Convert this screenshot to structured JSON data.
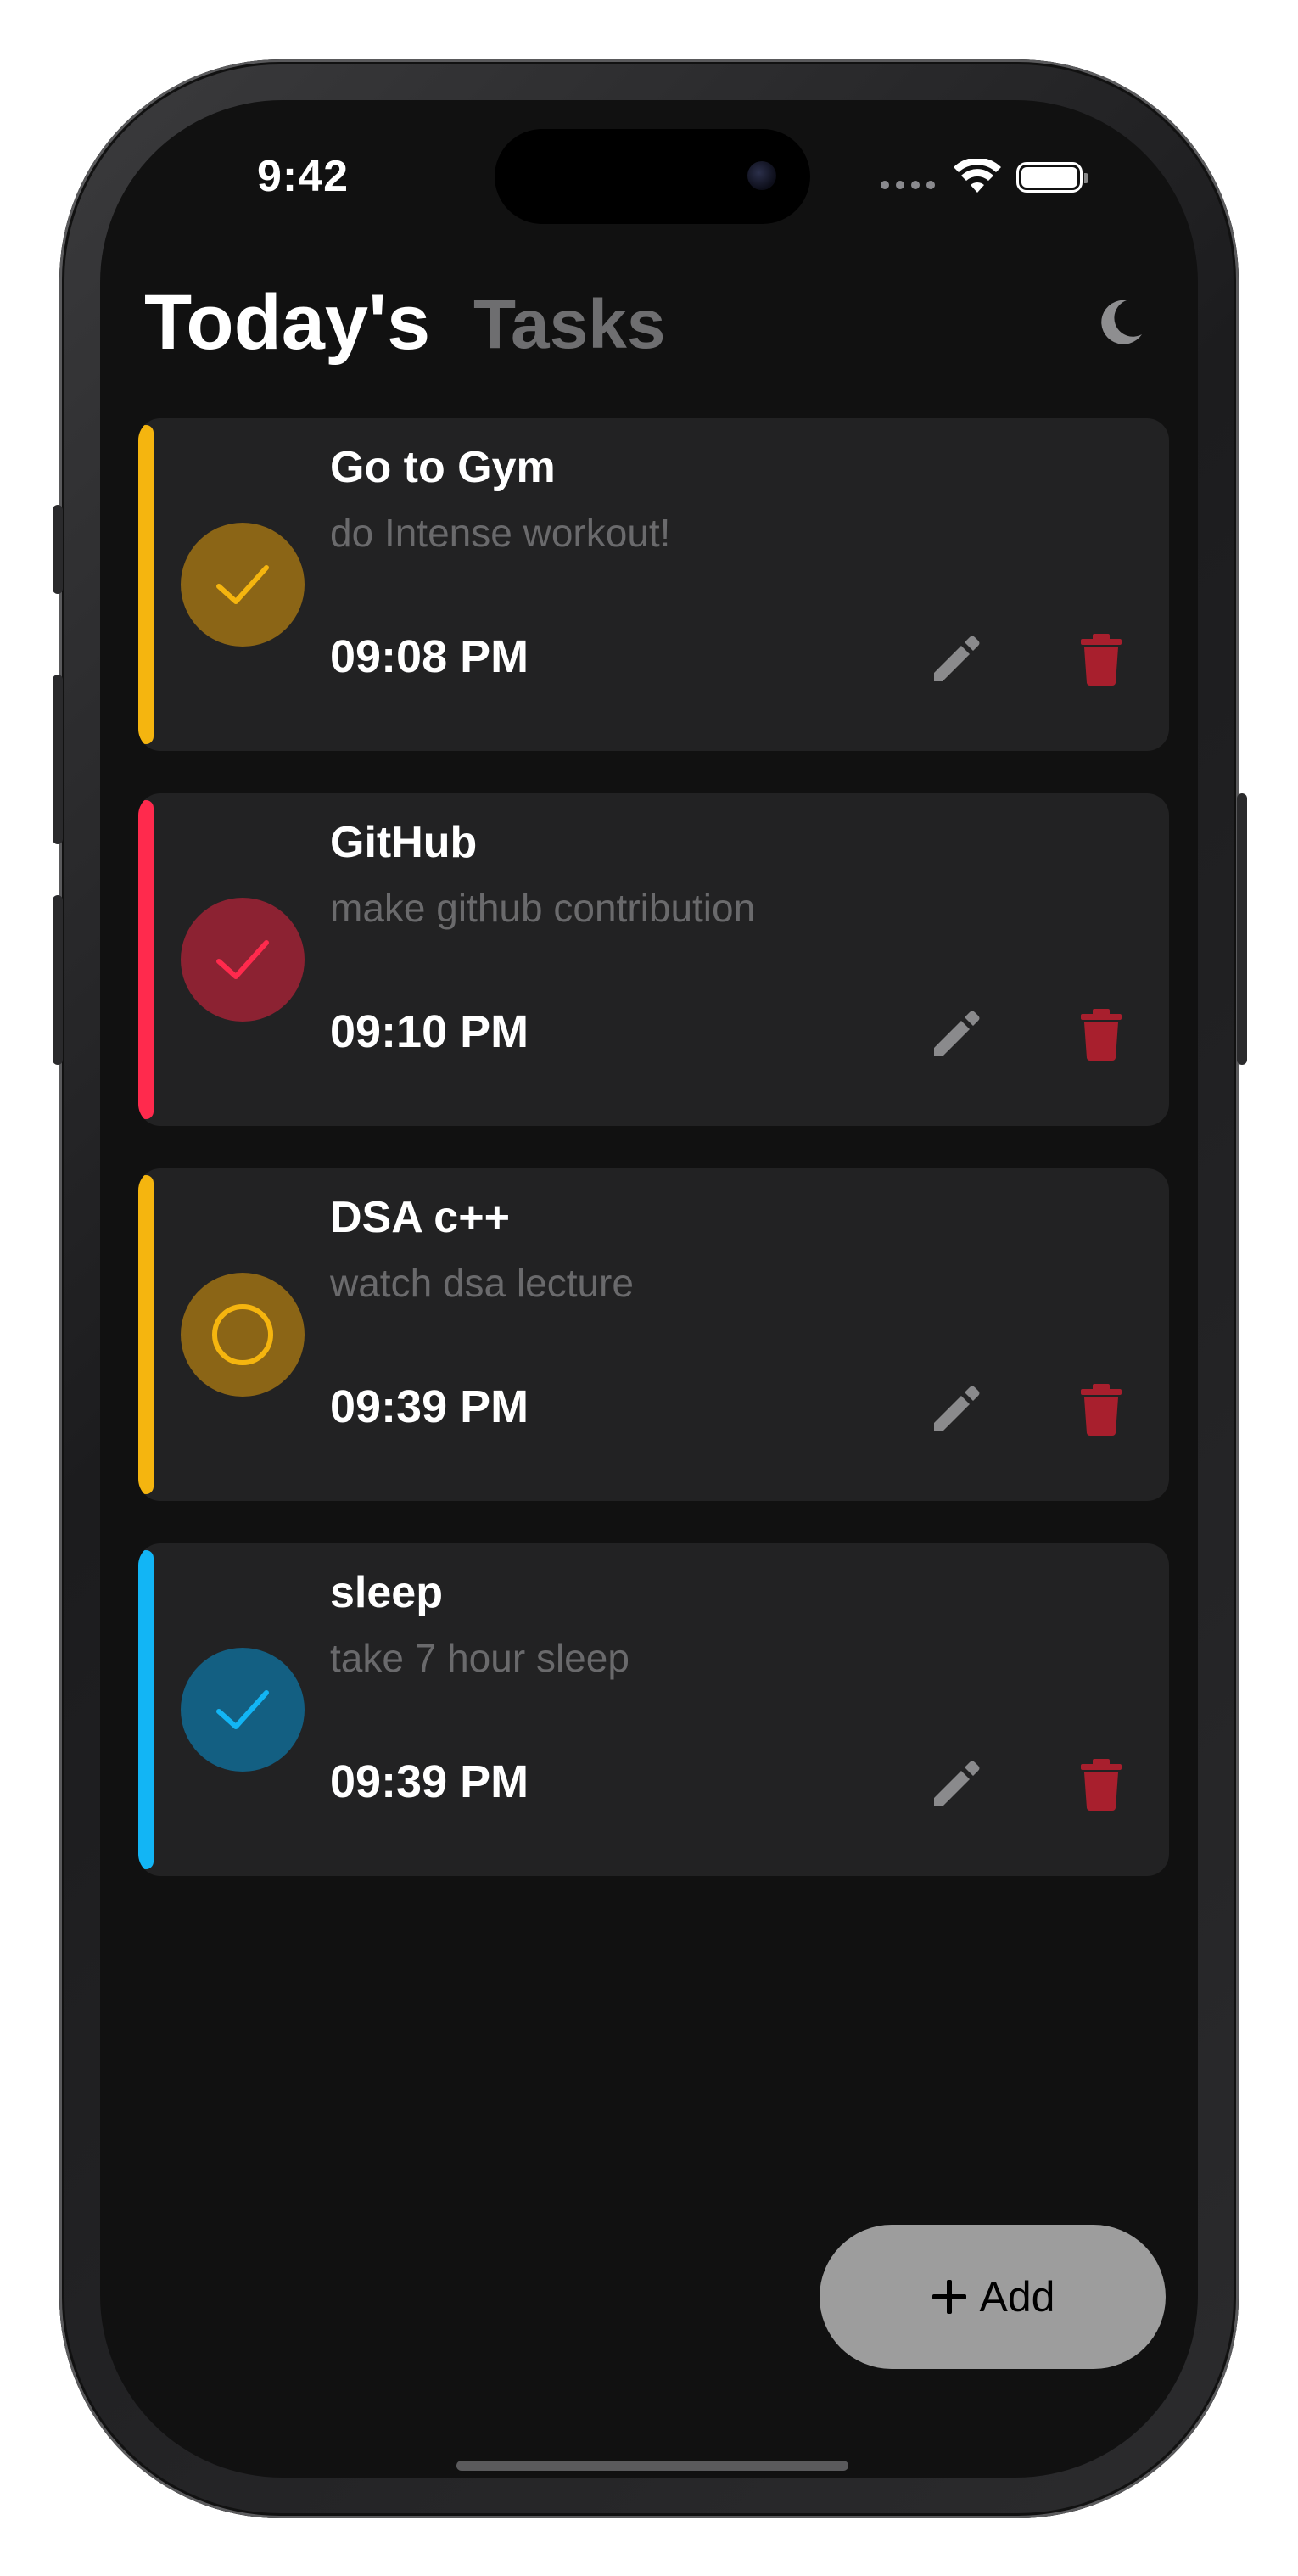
{
  "status_bar": {
    "time": "9:42"
  },
  "header": {
    "title": "Today's",
    "subtitle": "Tasks",
    "theme_icon": "moon-icon"
  },
  "tasks": [
    {
      "title": "Go to Gym",
      "description": "do Intense workout!",
      "time": "09:08 PM",
      "completed": true,
      "accent_color": "#f5b50f",
      "circle_color": "#8b6516"
    },
    {
      "title": "GitHub",
      "description": "make github contribution",
      "time": "09:10 PM",
      "completed": true,
      "accent_color": "#ff2a4d",
      "circle_color": "#8c2232"
    },
    {
      "title": "DSA c++",
      "description": "watch dsa lecture",
      "time": "09:39 PM",
      "completed": false,
      "accent_color": "#f5b50f",
      "circle_color": "#8b6516"
    },
    {
      "title": "sleep",
      "description": "take 7 hour sleep",
      "time": "09:39 PM",
      "completed": true,
      "accent_color": "#12b5f5",
      "circle_color": "#135f82"
    }
  ],
  "actions": {
    "edit_icon": "pencil-icon",
    "delete_icon": "trash-icon",
    "delete_color": "#a81f2d",
    "edit_color": "#8a8a8c"
  },
  "add_button": {
    "icon": "plus-icon",
    "label": "Add"
  }
}
